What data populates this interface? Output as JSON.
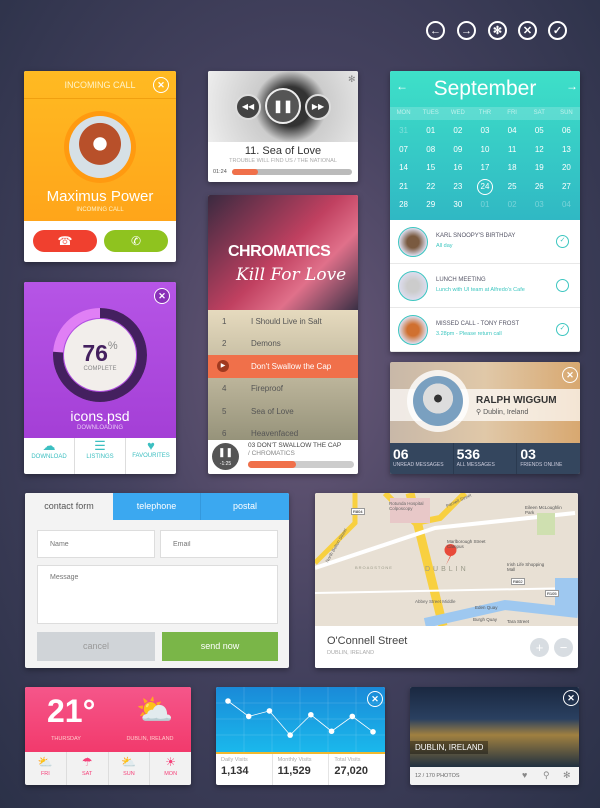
{
  "toolbar": {
    "icons": [
      "back-icon",
      "forward-icon",
      "gear-icon",
      "close-icon",
      "check-icon"
    ],
    "glyphs": [
      "←",
      "→",
      "✻",
      "✕",
      "✓"
    ]
  },
  "call": {
    "header": "INCOMING CALL",
    "name": "Maximus Power",
    "status": "INCOMING CALL",
    "colors": {
      "bg": "#ffb020",
      "decline": "#f0402f",
      "accept": "#8fc31f"
    }
  },
  "download": {
    "percent": 76,
    "percent_sign": "%",
    "complete_label": "COMPLETE",
    "filename": "icons.psd",
    "status": "DOWNLOADING",
    "tabs": [
      {
        "label": "DOWNLOAD",
        "icon": "cloud-download-icon"
      },
      {
        "label": "LISTINGS",
        "icon": "list-icon"
      },
      {
        "label": "FAVOURITES",
        "icon": "heart-icon"
      }
    ],
    "colors": {
      "bg": "#b34ee0",
      "ring": "#44205f",
      "accent": "#3cbfc1"
    }
  },
  "player": {
    "title": "11. Sea of Love",
    "subtitle": "TROUBLE WILL FIND US  /  THE NATIONAL",
    "time": "01:24",
    "progress": 0.22,
    "accent": "#f0704a"
  },
  "album": {
    "artist": "CHROMATICS",
    "album": "Kill For Love",
    "tracks": [
      {
        "num": "1",
        "title": "I Should Live in Salt"
      },
      {
        "num": "2",
        "title": "Demons"
      },
      {
        "num": "3",
        "title": "Don't Swallow the Cap",
        "active": true
      },
      {
        "num": "4",
        "title": "Fireproof"
      },
      {
        "num": "5",
        "title": "Sea of Love"
      },
      {
        "num": "6",
        "title": "Heavenfaced"
      }
    ],
    "now_playing": "03 DON'T SWALLOW THE CAP",
    "now_playing_artist": "/  CHROMATICS",
    "remaining": "-1:25",
    "progress": 0.45
  },
  "calendar": {
    "month": "September",
    "days": [
      "MON",
      "TUES",
      "WED",
      "THR",
      "FRI",
      "SAT",
      "SUN"
    ],
    "dates": [
      [
        "31",
        "01",
        "02",
        "03",
        "04",
        "05",
        "06"
      ],
      [
        "07",
        "08",
        "09",
        "10",
        "11",
        "12",
        "13"
      ],
      [
        "14",
        "15",
        "16",
        "17",
        "18",
        "19",
        "20"
      ],
      [
        "21",
        "22",
        "23",
        "24",
        "25",
        "26",
        "27"
      ],
      [
        "28",
        "29",
        "30",
        "01",
        "02",
        "03",
        "04"
      ]
    ],
    "selected": "24",
    "events": [
      {
        "title": "KARL SNOOPY'S BIRTHDAY",
        "detail": "All day",
        "done": true
      },
      {
        "title": "LUNCH MEETING",
        "detail": "Lunch with UI team at Alfredo's Cafe",
        "done": false
      },
      {
        "title": "MISSED CALL - TONY FROST",
        "detail": "3.28pm - Please return call",
        "done": true
      }
    ],
    "accent": "#3dd6c4"
  },
  "profile": {
    "name": "RALPH WIGGUM",
    "location": "Dublin, Ireland",
    "stats": [
      {
        "value": "06",
        "label": "UNREAD MESSAGES"
      },
      {
        "value": "536",
        "label": "ALL MESSAGES"
      },
      {
        "value": "03",
        "label": "FRIENDS ONLINE"
      }
    ]
  },
  "contact": {
    "tabs": [
      "contact form",
      "telephone",
      "postal"
    ],
    "name_placeholder": "Name",
    "email_placeholder": "Email",
    "message_placeholder": "Message",
    "cancel": "cancel",
    "send": "send now"
  },
  "map": {
    "street": "O'Connell Street",
    "city": "DUBLIN, IRELAND",
    "labels": [
      "DUBLIN",
      "BROADSTONE",
      "Rotunda Hospital Colposcopy",
      "Marlborough Street Campus",
      "Irish Life Shopping Mall",
      "Eileen McLoughlin Park",
      "Eden Quay",
      "Burgh Quay",
      "Tara Street",
      "Abbey Street Middle",
      "North Bolton Street",
      "Parnell Street",
      "R804",
      "R802",
      "R105"
    ]
  },
  "weather": {
    "temp": "21°",
    "day": "THURSDAY",
    "location": "DUBLIN, IRELAND",
    "forecast": [
      {
        "day": "FRI",
        "icon": "partly-cloudy-icon"
      },
      {
        "day": "SAT",
        "icon": "rain-icon"
      },
      {
        "day": "SUN",
        "icon": "partly-cloudy-icon"
      },
      {
        "day": "MON",
        "icon": "sun-icon"
      }
    ],
    "color": "#f5427a"
  },
  "visits": {
    "stats": [
      {
        "label": "Daily Visits",
        "value": "1,134"
      },
      {
        "label": "Monthly Visits",
        "value": "11,529"
      },
      {
        "label": "Total Visits",
        "value": "27,020"
      }
    ]
  },
  "chart_data": {
    "type": "line",
    "values": [
      80,
      52,
      62,
      18,
      55,
      25,
      52,
      24
    ],
    "ylim": [
      0,
      100
    ],
    "grid": true,
    "color": "#ffffff"
  },
  "photo": {
    "caption": "DUBLIN, IRELAND",
    "count": "12 / 170 PHOTOS"
  }
}
